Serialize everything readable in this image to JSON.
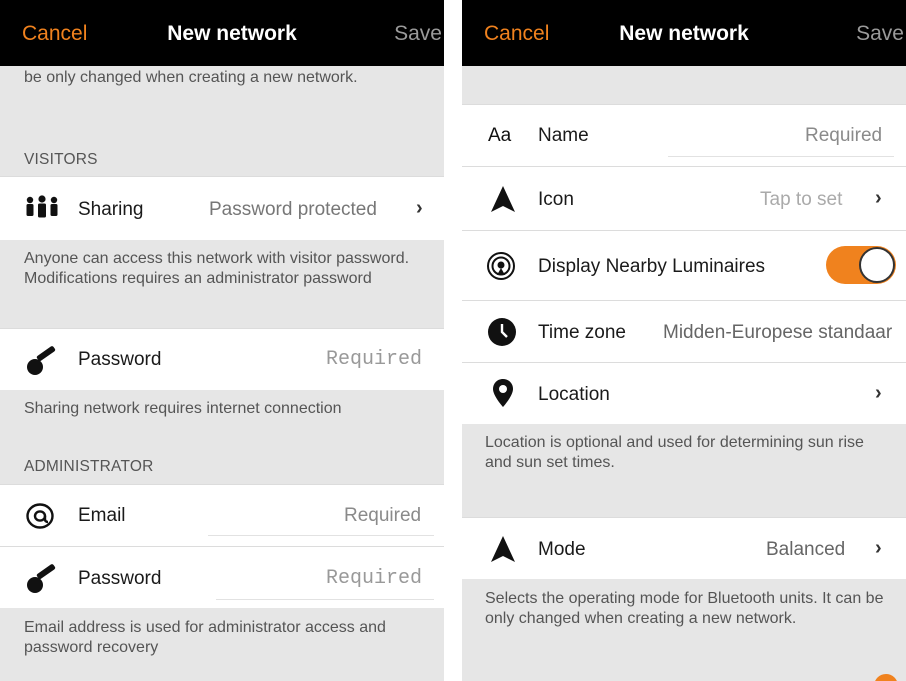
{
  "left": {
    "header": {
      "cancel": "Cancel",
      "title": "New network",
      "save": "Save"
    },
    "top_note": "be only changed when creating a new network.",
    "visitors": {
      "section": "VISITORS",
      "sharing": {
        "label": "Sharing",
        "value": "Password protected"
      },
      "sharing_note": "Anyone can access this network with visitor password. Modifications requires an administrator password",
      "password": {
        "label": "Password",
        "placeholder": "Required"
      },
      "password_note": "Sharing network requires internet connection"
    },
    "administrator": {
      "section": "ADMINISTRATOR",
      "email": {
        "label": "Email",
        "placeholder": "Required"
      },
      "password": {
        "label": "Password",
        "placeholder": "Required"
      },
      "note": "Email address is used for administrator access and password recovery"
    }
  },
  "right": {
    "header": {
      "cancel": "Cancel",
      "title": "New network",
      "save": "Save"
    },
    "name": {
      "icon_text": "Aa",
      "label": "Name",
      "placeholder": "Required"
    },
    "icon_row": {
      "label": "Icon",
      "value": "Tap to set"
    },
    "nearby": {
      "label": "Display Nearby Luminaires",
      "enabled": true
    },
    "timezone": {
      "label": "Time zone",
      "value": "Midden-Europese standaar"
    },
    "location": {
      "label": "Location"
    },
    "location_note": "Location is optional and used for determining sun rise and sun set times.",
    "mode": {
      "label": "Mode",
      "value": "Balanced"
    },
    "mode_note": "Selects the operating mode for Bluetooth units. It can be only changed when creating a new network."
  },
  "colors": {
    "accent": "#f0821e",
    "header_bg": "#000000",
    "section_bg": "#e6e6e6"
  }
}
